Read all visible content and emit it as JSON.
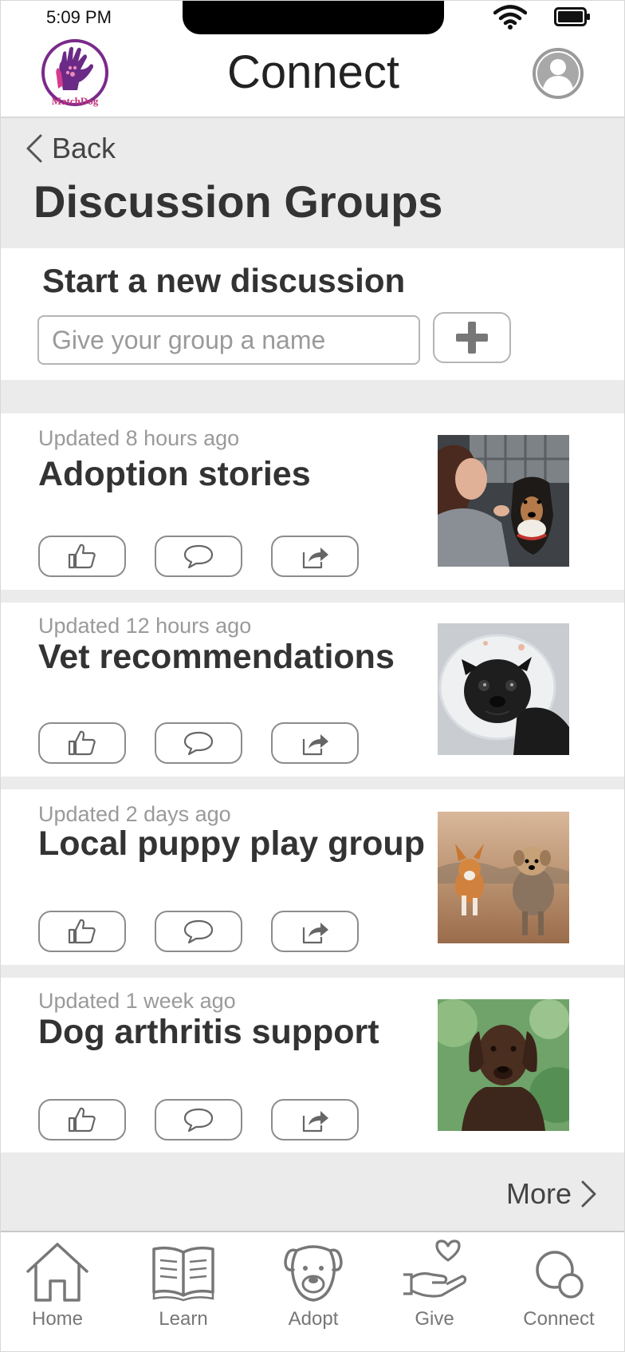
{
  "status_bar": {
    "time": "5:09 PM"
  },
  "header": {
    "logo_text": "MatchDog",
    "title": "Connect"
  },
  "nav": {
    "back_label": "Back",
    "page_title": "Discussion Groups"
  },
  "new_discussion": {
    "title": "Start a new discussion",
    "input_placeholder": "Give your group a name",
    "input_value": ""
  },
  "groups": [
    {
      "updated": "Updated 8 hours ago",
      "name": "Adoption stories",
      "image": "woman-with-dog-photo"
    },
    {
      "updated": "Updated 12 hours ago",
      "name": "Vet recommendations",
      "image": "pug-with-cone-photo"
    },
    {
      "updated": "Updated 2 days ago",
      "name": "Local puppy play group",
      "image": "corgi-and-terrier-photo"
    },
    {
      "updated": "Updated 1 week ago",
      "name": "Dog arthritis support",
      "image": "chocolate-labrador-photo"
    }
  ],
  "actions": {
    "like_icon": "thumbs-up-icon",
    "comment_icon": "speech-bubble-icon",
    "share_icon": "share-arrow-icon"
  },
  "more_label": "More",
  "tabs": [
    {
      "label": "Home",
      "icon": "house-icon"
    },
    {
      "label": "Learn",
      "icon": "open-book-icon"
    },
    {
      "label": "Adopt",
      "icon": "dog-face-icon"
    },
    {
      "label": "Give",
      "icon": "hand-heart-icon"
    },
    {
      "label": "Connect",
      "icon": "connect-circles-icon"
    }
  ],
  "colors": {
    "band_gray": "#ebebeb",
    "text_dark": "#333333",
    "text_muted": "#9a9a9a",
    "logo_purple": "#7a2a8a",
    "logo_pink": "#d63a8e"
  }
}
